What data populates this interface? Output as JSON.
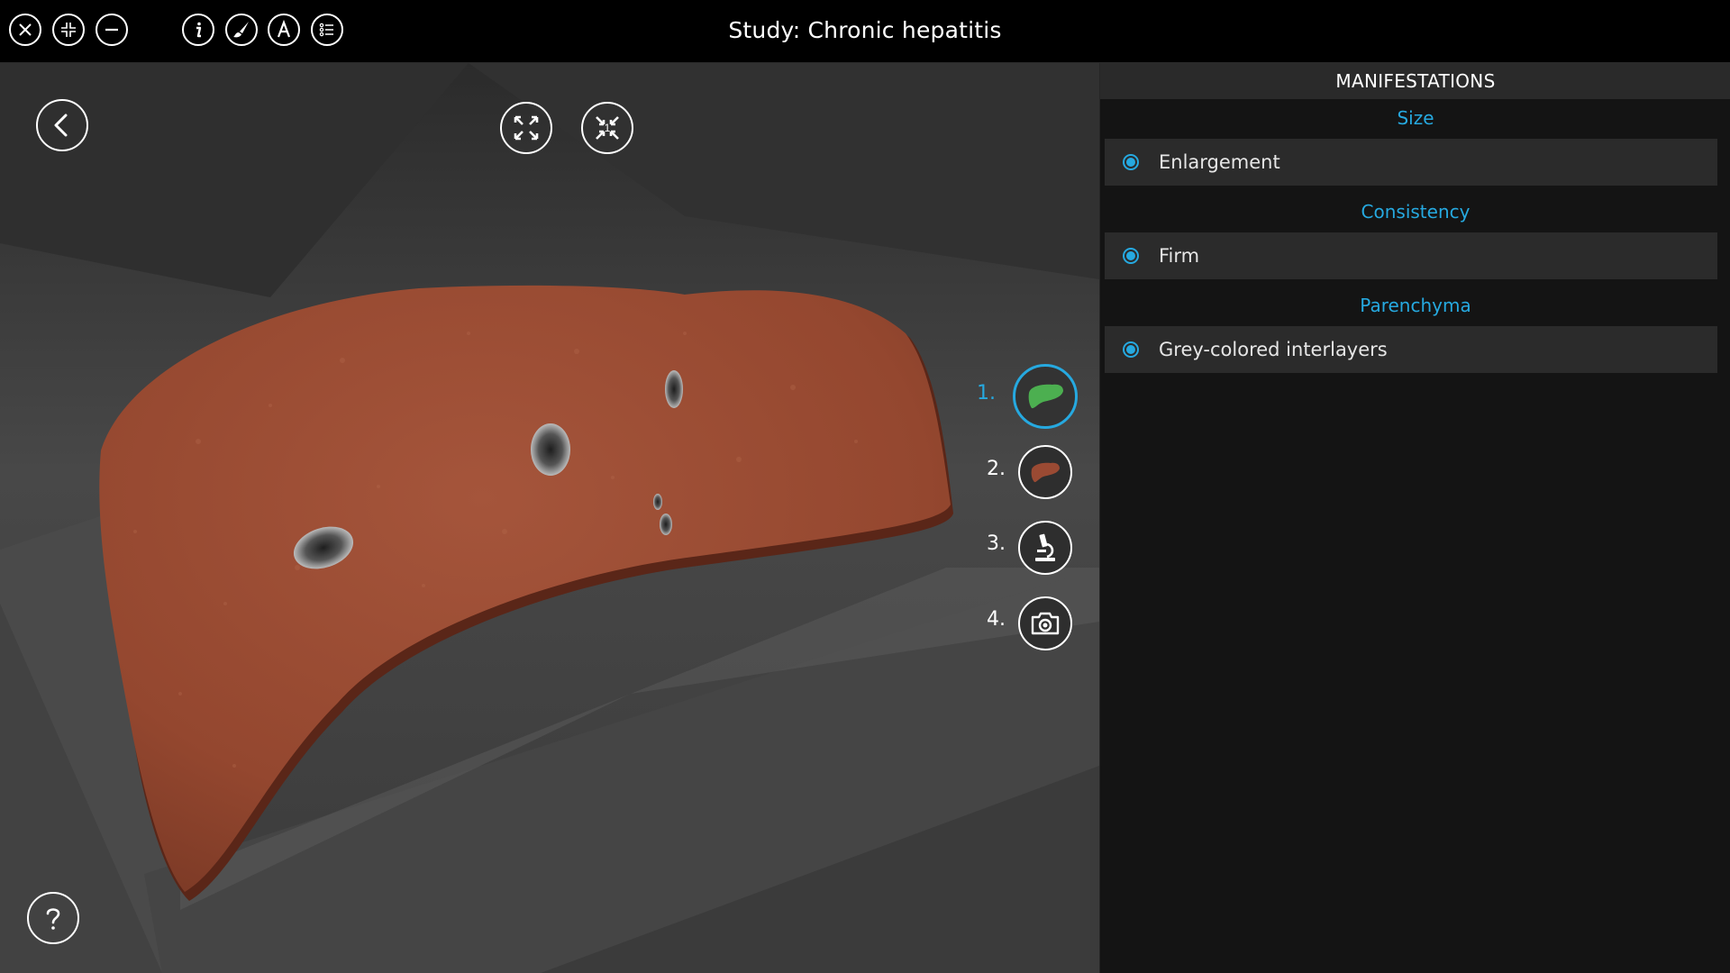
{
  "app": {
    "title": "Study: Chronic hepatitis"
  },
  "toolbar": {
    "left_icons": [
      "close-icon",
      "shrink-icon",
      "minimize-icon"
    ],
    "tool_icons": [
      "info-icon",
      "brush-icon",
      "annotation-icon",
      "list-icon"
    ]
  },
  "viewport": {
    "nav_icons": [
      "back-icon",
      "fit-view-icon",
      "focus-view-icon"
    ],
    "focus_badge": "1",
    "steps": [
      {
        "label": "1.",
        "icon": "liver-green-icon",
        "active": true
      },
      {
        "label": "2.",
        "icon": "liver-brown-icon",
        "active": false
      },
      {
        "label": "3.",
        "icon": "microscope-icon",
        "active": false
      },
      {
        "label": "4.",
        "icon": "camera-icon",
        "active": false
      }
    ],
    "help_icon": "help-icon"
  },
  "panel": {
    "header": "MANIFESTATIONS",
    "sections": [
      {
        "title": "Size",
        "items": [
          {
            "label": "Enlargement",
            "selected": true
          }
        ]
      },
      {
        "title": "Consistency",
        "items": [
          {
            "label": "Firm",
            "selected": true
          }
        ]
      },
      {
        "title": "Parenchyma",
        "items": [
          {
            "label": "Grey-colored interlayers",
            "selected": true
          }
        ]
      }
    ]
  },
  "colors": {
    "accent": "#26a9e0",
    "liver": "#9a4a33",
    "liver_icon_green": "#4caf50",
    "liver_icon_brown": "#9a4a33"
  }
}
